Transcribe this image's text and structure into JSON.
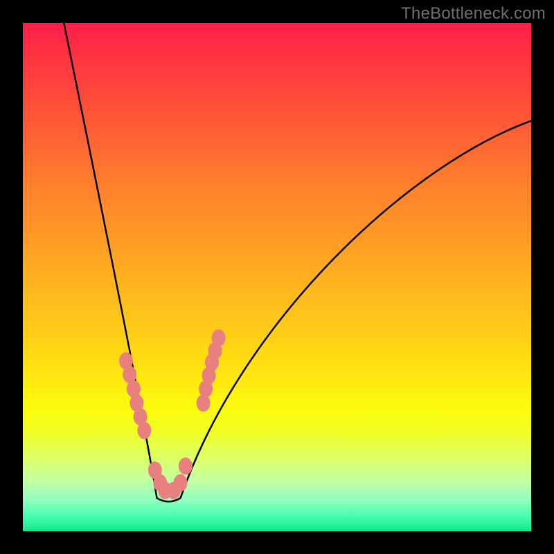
{
  "watermark": "TheBottleneck.com",
  "chart_data": {
    "type": "line",
    "title": "",
    "xlabel": "",
    "ylabel": "",
    "xlim": [
      0,
      734
    ],
    "ylim": [
      0,
      734
    ],
    "grid": false,
    "curve": {
      "description": "V-shaped bottleneck curve; minimum near x≈0.28 of width, rising steeply to the left and gently to the right",
      "shape": "asymmetric-v",
      "min_x_fraction": 0.28,
      "left_top_fraction": 0.0,
      "right_top_fraction": 0.19
    },
    "markers": {
      "color": "#e98080",
      "radius": 10,
      "points_fraction_of_plot": [
        [
          0.203,
          0.665
        ],
        [
          0.21,
          0.692
        ],
        [
          0.218,
          0.72
        ],
        [
          0.224,
          0.748
        ],
        [
          0.231,
          0.775
        ],
        [
          0.239,
          0.802
        ],
        [
          0.26,
          0.88
        ],
        [
          0.27,
          0.905
        ],
        [
          0.28,
          0.92
        ],
        [
          0.297,
          0.92
        ],
        [
          0.31,
          0.905
        ],
        [
          0.32,
          0.872
        ],
        [
          0.355,
          0.748
        ],
        [
          0.36,
          0.72
        ],
        [
          0.366,
          0.694
        ],
        [
          0.372,
          0.668
        ],
        [
          0.378,
          0.645
        ],
        [
          0.385,
          0.62
        ]
      ]
    },
    "background_gradient": {
      "top": "#ff1e47",
      "middle": "#ffd016",
      "bottom": "#15e88a"
    }
  }
}
